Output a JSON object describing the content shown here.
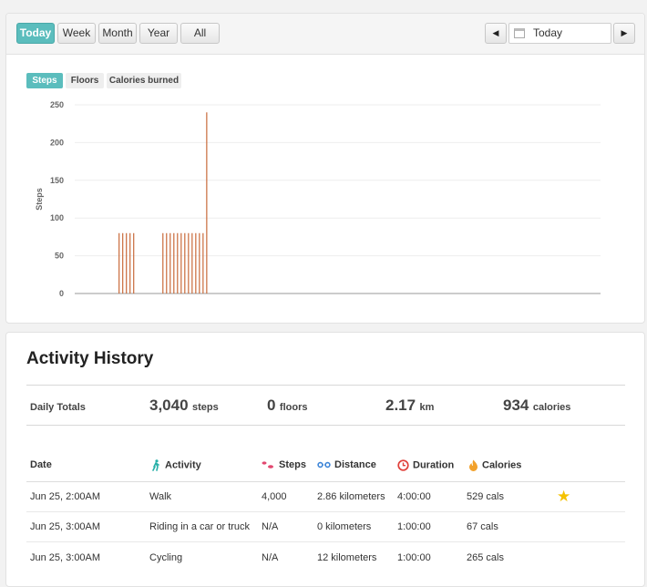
{
  "toolbar": {
    "ranges": [
      "Today",
      "Week",
      "Month",
      "Year",
      "All"
    ],
    "active_range": "Today",
    "prev_icon": "◀",
    "next_icon": "▶",
    "date_value": "Today"
  },
  "chart_tabs": [
    "Steps",
    "Floors",
    "Calories burned"
  ],
  "active_chart_tab": "Steps",
  "colors": {
    "accent": "#5bbdbd",
    "bar": "#c96a3a",
    "axis": "#999999",
    "grid": "#eeeeee"
  },
  "chart_data": {
    "type": "bar",
    "ylabel": "Steps",
    "xlabel": "",
    "title": "",
    "ylim": [
      0,
      250
    ],
    "yticks": [
      0,
      50,
      100,
      150,
      200,
      250
    ],
    "slots": 144,
    "bars": [
      {
        "slot": 12,
        "value": 80
      },
      {
        "slot": 13,
        "value": 80
      },
      {
        "slot": 14,
        "value": 80
      },
      {
        "slot": 15,
        "value": 80
      },
      {
        "slot": 16,
        "value": 80
      },
      {
        "slot": 24,
        "value": 80
      },
      {
        "slot": 25,
        "value": 80
      },
      {
        "slot": 26,
        "value": 80
      },
      {
        "slot": 27,
        "value": 80
      },
      {
        "slot": 28,
        "value": 80
      },
      {
        "slot": 29,
        "value": 80
      },
      {
        "slot": 30,
        "value": 80
      },
      {
        "slot": 31,
        "value": 80
      },
      {
        "slot": 32,
        "value": 80
      },
      {
        "slot": 33,
        "value": 80
      },
      {
        "slot": 34,
        "value": 80
      },
      {
        "slot": 35,
        "value": 80
      },
      {
        "slot": 36,
        "value": 240
      }
    ]
  },
  "history": {
    "title": "Activity History",
    "totals_label": "Daily Totals",
    "totals": [
      {
        "value": "3,040",
        "unit": "steps"
      },
      {
        "value": "0",
        "unit": "floors"
      },
      {
        "value": "2.17",
        "unit": "km"
      },
      {
        "value": "934",
        "unit": "calories"
      }
    ],
    "columns": [
      {
        "label": "Date",
        "icon": ""
      },
      {
        "label": "Activity",
        "icon": "walker-icon"
      },
      {
        "label": "Steps",
        "icon": "footprints-icon"
      },
      {
        "label": "Distance",
        "icon": "distance-icon"
      },
      {
        "label": "Duration",
        "icon": "clock-icon"
      },
      {
        "label": "Calories",
        "icon": "flame-icon"
      }
    ],
    "rows": [
      {
        "date": "Jun 25, 2:00AM",
        "activity": "Walk",
        "steps": "4,000",
        "distance": "2.86 kilometers",
        "duration": "4:00:00",
        "calories": "529 cals",
        "starred": true
      },
      {
        "date": "Jun 25, 3:00AM",
        "activity": "Riding in a car or truck",
        "steps": "N/A",
        "distance": "0 kilometers",
        "duration": "1:00:00",
        "calories": "67 cals",
        "starred": false
      },
      {
        "date": "Jun 25, 3:00AM",
        "activity": "Cycling",
        "steps": "N/A",
        "distance": "12 kilometers",
        "duration": "1:00:00",
        "calories": "265 cals",
        "starred": false
      }
    ]
  }
}
